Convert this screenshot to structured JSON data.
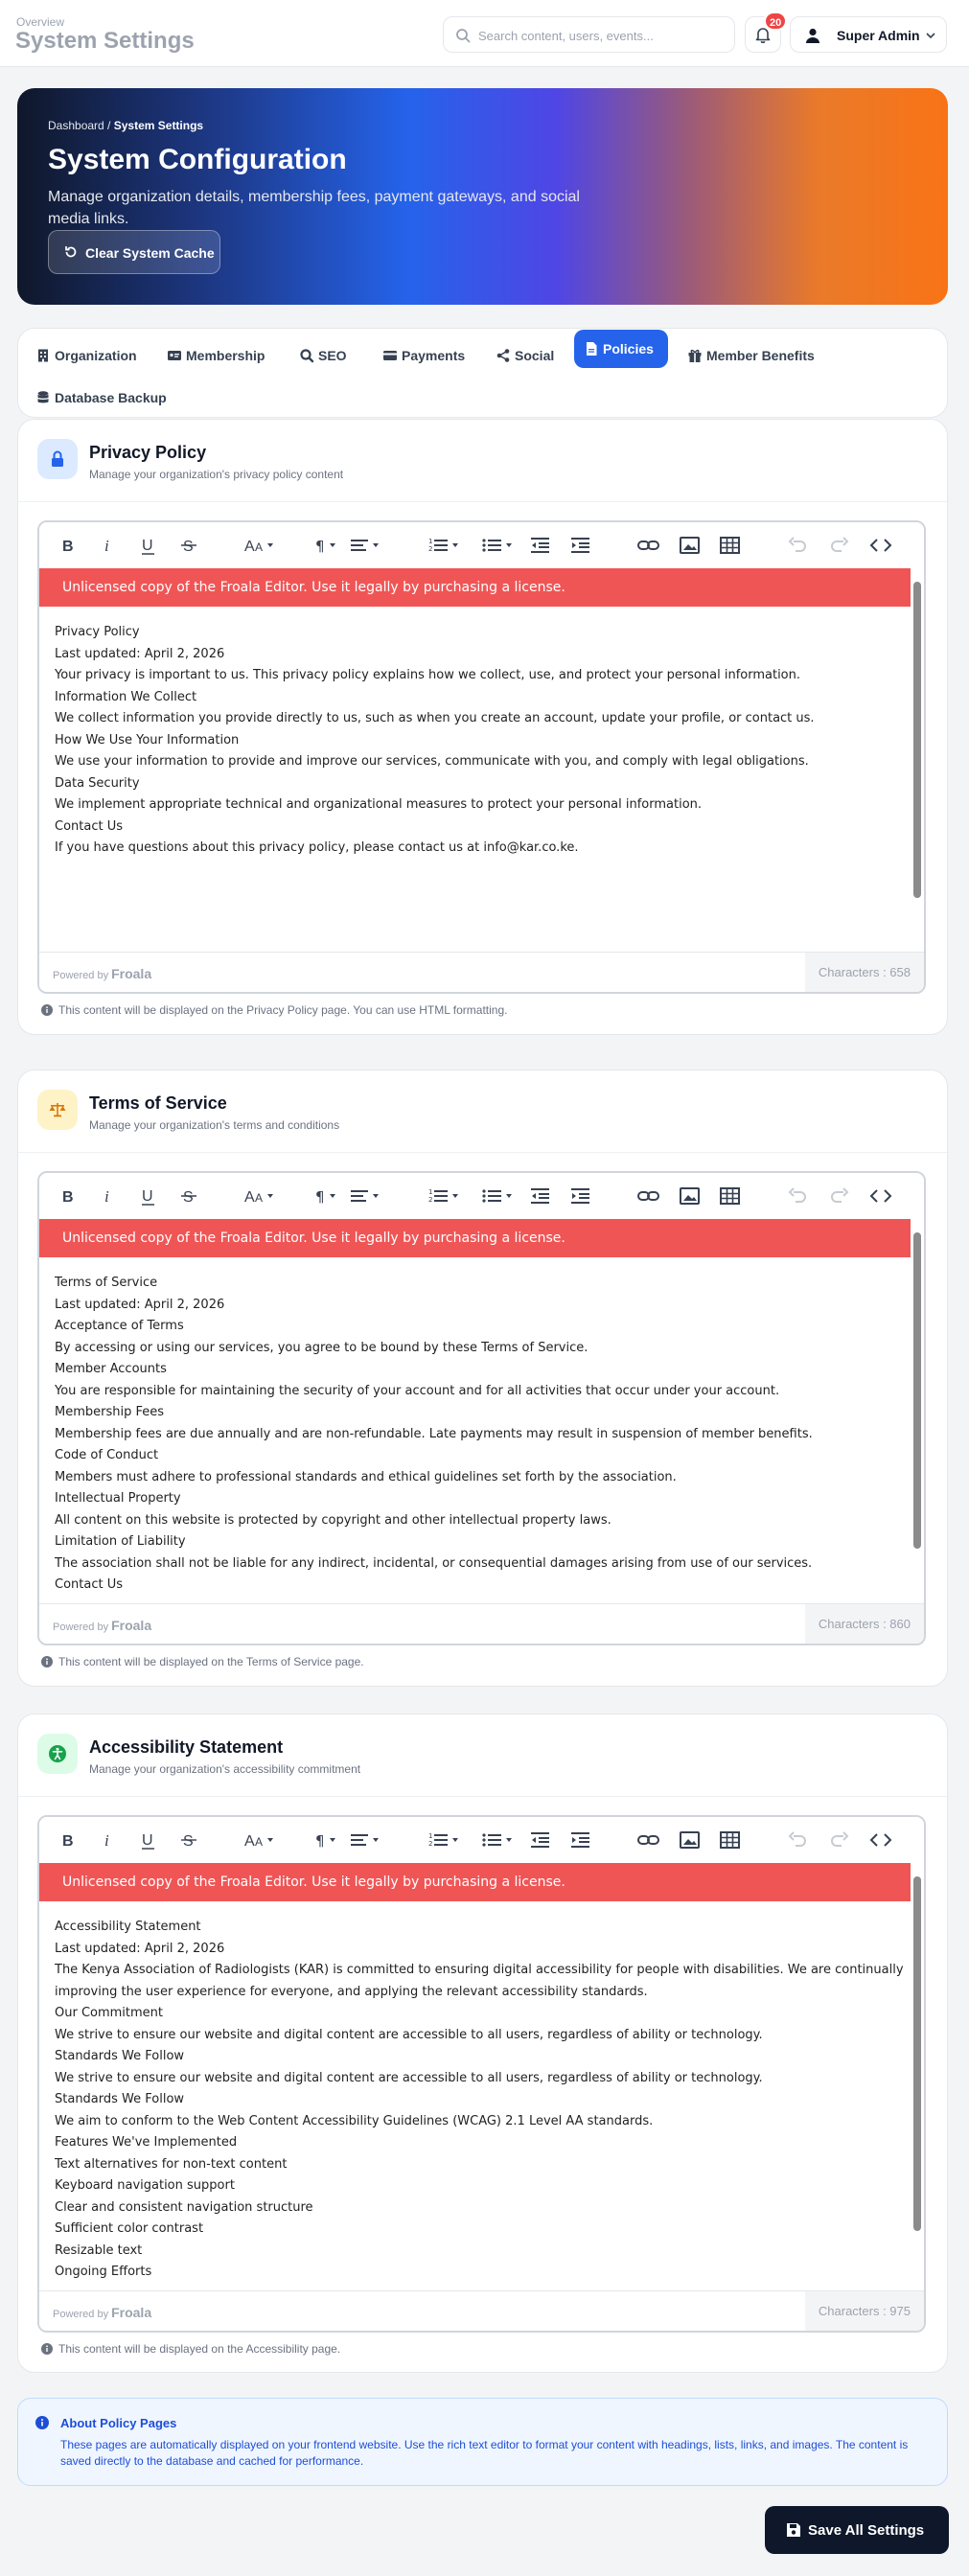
{
  "topbar": {
    "breadcrumb": "Overview",
    "title": "System Settings",
    "search_placeholder": "Search content, users, events...",
    "notification_count": "20",
    "user_name": "Super Admin"
  },
  "hero": {
    "breadcrumb_root": "Dashboard",
    "breadcrumb_sep": " / ",
    "breadcrumb_current": "System Settings",
    "title": "System Configuration",
    "description": "Manage organization details, membership fees, payment gateways, and social media links.",
    "cache_button": "Clear System Cache"
  },
  "tabs": [
    {
      "label": "Organization",
      "icon": "building-icon"
    },
    {
      "label": "Membership",
      "icon": "id-card-icon"
    },
    {
      "label": "SEO",
      "icon": "search-icon"
    },
    {
      "label": "Payments",
      "icon": "credit-card-icon"
    },
    {
      "label": "Social",
      "icon": "share-icon"
    },
    {
      "label": "Policies",
      "icon": "file-icon",
      "active": true
    },
    {
      "label": "Member Benefits",
      "icon": "gift-icon"
    },
    {
      "label": "Database Backup",
      "icon": "database-icon"
    }
  ],
  "editor": {
    "banner": "Unlicensed copy of the Froala Editor. Use it legally by purchasing a license.",
    "powered_by": "Powered by",
    "brand": "Froala"
  },
  "policies": [
    {
      "title": "Privacy Policy",
      "subtitle": "Manage your organization's privacy policy content",
      "icon": "lock-icon",
      "characters": "Characters : 658",
      "hint": "This content will be displayed on the Privacy Policy page. You can use HTML formatting.",
      "lines": [
        "Privacy Policy",
        "Last updated: April 2, 2026",
        "Your privacy is important to us. This privacy policy explains how we collect, use, and protect your personal information.",
        "Information We Collect",
        "We collect information you provide directly to us, such as when you create an account, update your profile, or contact us.",
        "How We Use Your Information",
        "We use your information to provide and improve our services, communicate with you, and comply with legal obligations.",
        "Data Security",
        "We implement appropriate technical and organizational measures to protect your personal information.",
        "Contact Us",
        "If you have questions about this privacy policy, please contact us at info@kar.co.ke."
      ]
    },
    {
      "title": "Terms of Service",
      "subtitle": "Manage your organization's terms and conditions",
      "icon": "scale-icon",
      "characters": "Characters : 860",
      "hint": "This content will be displayed on the Terms of Service page.",
      "lines": [
        "Terms of Service",
        "Last updated: April 2, 2026",
        "Acceptance of Terms",
        "By accessing or using our services, you agree to be bound by these Terms of Service.",
        "Member Accounts",
        "You are responsible for maintaining the security of your account and for all activities that occur under your account.",
        "Membership Fees",
        "Membership fees are due annually and are non-refundable. Late payments may result in suspension of member benefits.",
        "Code of Conduct",
        "Members must adhere to professional standards and ethical guidelines set forth by the association.",
        "Intellectual Property",
        "All content on this website is protected by copyright and other intellectual property laws.",
        "Limitation of Liability",
        "The association shall not be liable for any indirect, incidental, or consequential damages arising from use of our services.",
        "Contact Us"
      ]
    },
    {
      "title": "Accessibility Statement",
      "subtitle": "Manage your organization's accessibility commitment",
      "icon": "accessibility-icon",
      "characters": "Characters : 975",
      "hint": "This content will be displayed on the Accessibility page.",
      "lines": [
        "Accessibility Statement",
        "Last updated: April 2, 2026",
        "The Kenya Association of Radiologists (KAR) is committed to ensuring digital accessibility for people with disabilities. We are continually improving the user experience for everyone, and applying the relevant accessibility standards.",
        "Our Commitment",
        "We strive to ensure our website and digital content are accessible to all users, regardless of ability or technology.",
        "Standards We Follow",
        "We strive to ensure our website and digital content are accessible to all users, regardless of ability or technology.",
        "Standards We Follow",
        "We aim to conform to the Web Content Accessibility Guidelines (WCAG) 2.1 Level AA standards.",
        "Features We've Implemented",
        "Text alternatives for non-text content",
        "Keyboard navigation support",
        "Clear and consistent navigation structure",
        "Sufficient color contrast",
        "Resizable text",
        "Ongoing Efforts"
      ]
    }
  ],
  "info": {
    "title": "About Policy Pages",
    "text": "These pages are automatically displayed on your frontend website. Use the rich text editor to format your content with headings, lists, links, and images. The content is saved directly to the database and cached for performance."
  },
  "save_button": "Save All Settings",
  "colors": {
    "accent": "#2563eb",
    "banner": "#f05556",
    "dark": "#0f172a"
  }
}
